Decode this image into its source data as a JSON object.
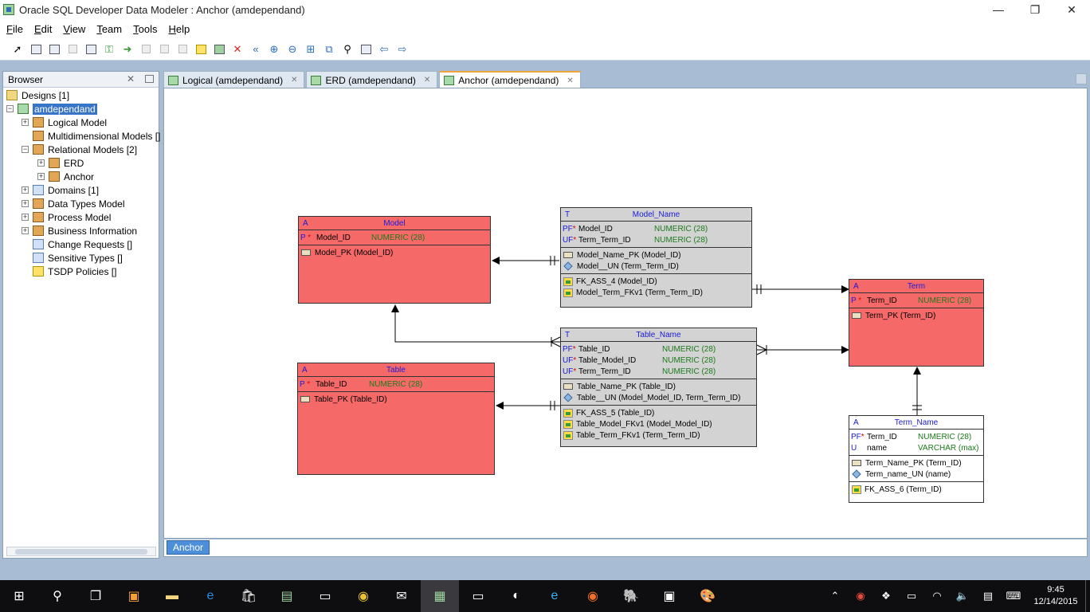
{
  "window": {
    "title": "Oracle SQL Developer Data Modeler : Anchor (amdependand)"
  },
  "menu": [
    "File",
    "Edit",
    "View",
    "Team",
    "Tools",
    "Help"
  ],
  "toolbar_icons": [
    "select-icon",
    "table-icon",
    "view-icon",
    "split-icon",
    "merge-icon",
    "new-fk-icon",
    "fk-arrow-icon",
    "disabled-icon",
    "disabled-icon",
    "disabled-icon",
    "note-icon",
    "picture-icon",
    "delete-icon",
    "zoom-back-icon",
    "zoom-in-icon",
    "zoom-out-icon",
    "fit-screen-icon",
    "copy-icon",
    "find-icon",
    "properties-icon",
    "back-icon",
    "forward-icon"
  ],
  "browser": {
    "title": "Browser",
    "tree": [
      {
        "label": "Designs [1]",
        "icon": "folder-icon"
      },
      {
        "label": "amdependand",
        "icon": "design-icon"
      },
      {
        "label": "Logical Model",
        "icon": "logical-model-icon"
      },
      {
        "label": "Multidimensional Models []",
        "icon": "multidim-icon"
      },
      {
        "label": "Relational Models [2]",
        "icon": "relational-icon"
      },
      {
        "label": "ERD",
        "icon": "model-icon"
      },
      {
        "label": "Anchor",
        "icon": "model-icon"
      },
      {
        "label": "Domains [1]",
        "icon": "domains-icon"
      },
      {
        "label": "Data Types Model",
        "icon": "datatypes-icon"
      },
      {
        "label": "Process Model",
        "icon": "process-icon"
      },
      {
        "label": "Business Information",
        "icon": "business-icon"
      },
      {
        "label": "Change Requests []",
        "icon": "change-requests-icon"
      },
      {
        "label": "Sensitive Types []",
        "icon": "sensitive-types-icon"
      },
      {
        "label": "TSDP Policies []",
        "icon": "tsdp-icon"
      }
    ]
  },
  "tabs": [
    "Logical (amdependand)",
    "ERD (amdependand)",
    "Anchor (amdependand)"
  ],
  "bottom_tab": "Anchor",
  "entities": {
    "model": {
      "tag": "A",
      "name": "Model",
      "rows": [
        {
          "k": "P",
          "star": "*",
          "col": "Model_ID",
          "type": "NUMERIC (28)"
        }
      ],
      "keys": [
        "Model_PK (Model_ID)"
      ]
    },
    "model_name": {
      "tag": "T",
      "name": "Model_Name",
      "rows": [
        {
          "k": "PF",
          "star": "*",
          "col": "Model_ID",
          "type": "NUMERIC (28)"
        },
        {
          "k": "UF",
          "star": "*",
          "col": "Term_Term_ID",
          "type": "NUMERIC (28)"
        }
      ],
      "keys": [
        "Model_Name_PK (Model_ID)",
        "Model__UN (Term_Term_ID)"
      ],
      "fks": [
        "FK_ASS_4 (Model_ID)",
        "Model_Term_FKv1 (Term_Term_ID)"
      ]
    },
    "term": {
      "tag": "A",
      "name": "Term",
      "rows": [
        {
          "k": "P",
          "star": "*",
          "col": "Term_ID",
          "type": "NUMERIC (28)"
        }
      ],
      "keys": [
        "Term_PK (Term_ID)"
      ]
    },
    "table_name": {
      "tag": "T",
      "name": "Table_Name",
      "rows": [
        {
          "k": "PF",
          "star": "*",
          "col": "Table_ID",
          "type": "NUMERIC (28)"
        },
        {
          "k": "UF",
          "star": "*",
          "col": "Table_Model_ID",
          "type": "NUMERIC (28)"
        },
        {
          "k": "UF",
          "star": "*",
          "col": "Term_Term_ID",
          "type": "NUMERIC (28)"
        }
      ],
      "keys": [
        "Table_Name_PK (Table_ID)",
        "Table__UN (Model_Model_ID, Term_Term_ID)"
      ],
      "fks": [
        "FK_ASS_5 (Table_ID)",
        "Table_Model_FKv1 (Model_Model_ID)",
        "Table_Term_FKv1 (Term_Term_ID)"
      ]
    },
    "table": {
      "tag": "A",
      "name": "Table",
      "rows": [
        {
          "k": "P",
          "star": "*",
          "col": "Table_ID",
          "type": "NUMERIC (28)"
        }
      ],
      "keys": [
        "Table_PK (Table_ID)"
      ]
    },
    "term_name": {
      "tag": "A",
      "name": "Term_Name",
      "rows": [
        {
          "k": "PF",
          "star": "*",
          "col": "Term_ID",
          "type": "NUMERIC (28)"
        },
        {
          "k": "U",
          "star": "",
          "col": "name",
          "type": "VARCHAR (max)"
        }
      ],
      "keys": [
        "Term_Name_PK (Term_ID)",
        "Term_name_UN (name)"
      ],
      "fks": [
        "FK_ASS_6 (Term_ID)"
      ]
    }
  },
  "taskbar": {
    "items": [
      "start-icon",
      "search-icon",
      "task-view-icon",
      "sublime-icon",
      "file-explorer-icon",
      "edge-icon",
      "store-icon",
      "notepad-icon",
      "cmd-icon",
      "chrome-icon",
      "mail-icon",
      "data-modeler-icon",
      "cmd-icon",
      "app-icon",
      "ie-icon",
      "firefox-icon",
      "postgres-icon",
      "monitor-icon",
      "paint-icon"
    ],
    "time": "9:45",
    "date": "12/14/2015"
  }
}
